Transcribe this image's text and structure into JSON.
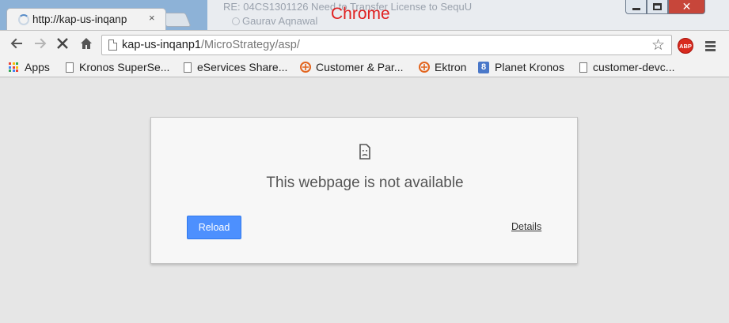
{
  "window": {
    "label": "Chrome",
    "background_text_line1": "RE: 04CS1301126 Need to Transfer License to SequU",
    "background_text_line2": "Gaurav Aqnawal"
  },
  "tab": {
    "title": "http://kap-us-inqanp",
    "close_glyph": "×"
  },
  "toolbar": {
    "url_host": "kap-us-inqanp1",
    "url_path": "/MicroStrategy/asp/",
    "abp_label": "ABP"
  },
  "bookmarks": [
    {
      "label": "Apps",
      "icon": "apps-grid-icon"
    },
    {
      "label": "Kronos SuperSe...",
      "icon": "page-icon"
    },
    {
      "label": "eServices Share...",
      "icon": "page-icon"
    },
    {
      "label": "Customer & Par...",
      "icon": "ektron-icon"
    },
    {
      "label": "Ektron",
      "icon": "ektron-icon"
    },
    {
      "label": "Planet Kronos",
      "icon": "planet-kronos-icon"
    },
    {
      "label": "customer-devc...",
      "icon": "page-icon"
    }
  ],
  "error": {
    "title": "This webpage is not available",
    "reload_label": "Reload",
    "details_label": "Details"
  },
  "colors": {
    "chrome_label": "#e02020",
    "reload_button": "#4d90fe",
    "close_button": "#c7463a",
    "abp_badge": "#d82a1e"
  }
}
